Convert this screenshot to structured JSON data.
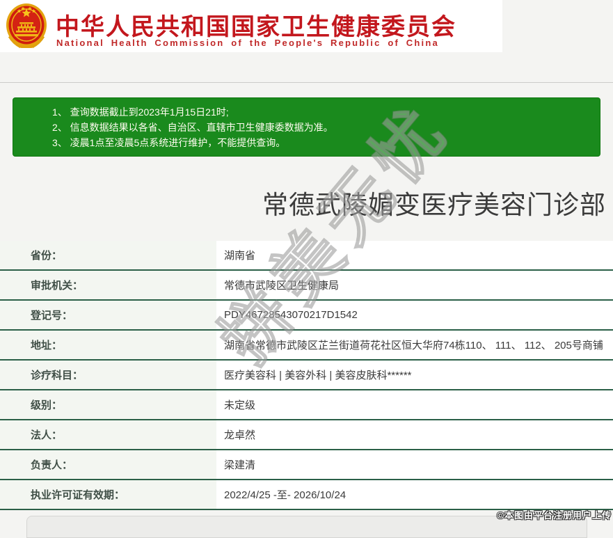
{
  "header": {
    "emblem_icon": "china-national-emblem",
    "org_cn": "中华人民共和国国家卫生健康委员会",
    "org_en": "National Health Commission of the People's Republic of China",
    "title_color": "#c3171d"
  },
  "notice": {
    "bg_color": "#1a8a1d",
    "lines": [
      "1、 查询数据截止到2023年1月15日21时;",
      "2、 信息数据结果以各省、自治区、直辖市卫生健康委数据为准。",
      "3、 凌晨1点至凌晨5点系统进行维护，不能提供查询。"
    ]
  },
  "result": {
    "title": "常德武陵媚变医疗美容门诊部",
    "row_border_color": "#2a5f47",
    "fields": [
      {
        "label": "省份：",
        "value": "湖南省"
      },
      {
        "label": "审批机关：",
        "value": "常德市武陵区卫生健康局"
      },
      {
        "label": "登记号：",
        "value": "PDY46728543070217D1542"
      },
      {
        "label": "地址：",
        "value": "湖南省常德市武陵区芷兰街道荷花社区恒大华府74栋110、 111、 112、 205号商铺"
      },
      {
        "label": "诊疗科目：",
        "value": "医疗美容科 | 美容外科 | 美容皮肤科******"
      },
      {
        "label": "级别：",
        "value": "未定级"
      },
      {
        "label": "法人：",
        "value": "龙卓然"
      },
      {
        "label": "负责人：",
        "value": "梁建清"
      },
      {
        "label": "执业许可证有效期：",
        "value": "2022/4/25 -至- 2026/10/24"
      }
    ]
  },
  "watermarks": {
    "diagonal": "拼美无忧",
    "footer": "©本图由平台注册用户上传"
  }
}
